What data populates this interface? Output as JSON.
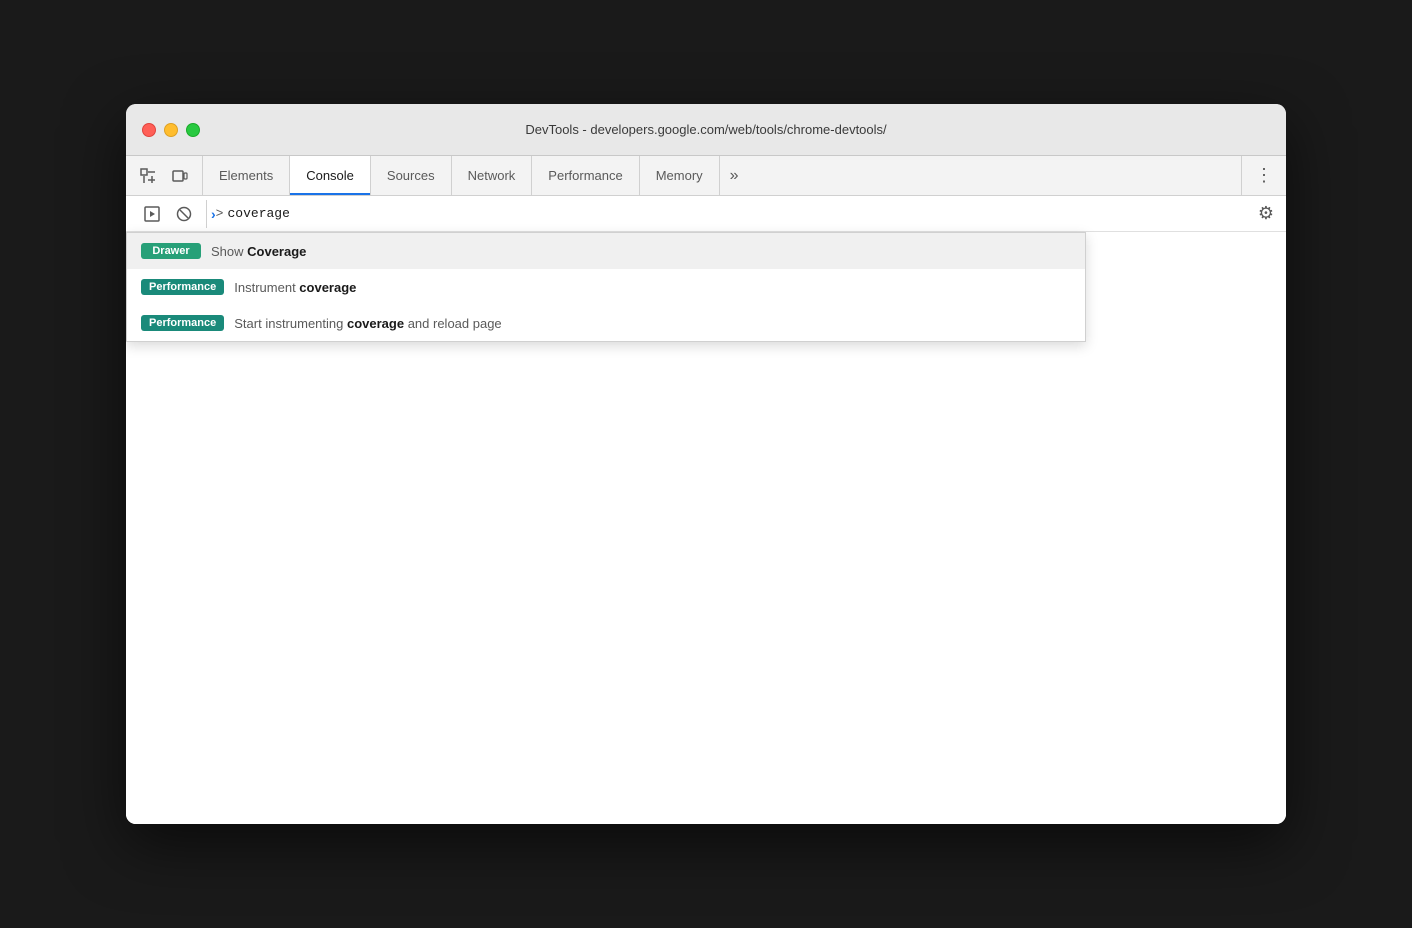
{
  "window": {
    "title": "DevTools - developers.google.com/web/tools/chrome-devtools/"
  },
  "traffic_lights": {
    "close_label": "close",
    "minimize_label": "minimize",
    "maximize_label": "maximize"
  },
  "tabs": [
    {
      "id": "elements",
      "label": "Elements",
      "active": false
    },
    {
      "id": "console",
      "label": "Console",
      "active": true
    },
    {
      "id": "sources",
      "label": "Sources",
      "active": false
    },
    {
      "id": "network",
      "label": "Network",
      "active": false
    },
    {
      "id": "performance",
      "label": "Performance",
      "active": false
    },
    {
      "id": "memory",
      "label": "Memory",
      "active": false
    }
  ],
  "tab_more_label": "»",
  "console_input": {
    "prompt": ">",
    "value": "coverage",
    "display": ">coverage"
  },
  "autocomplete": {
    "items": [
      {
        "badge_text": "Drawer",
        "badge_class": "badge-drawer",
        "text_before": "Show ",
        "text_bold": "Coverage",
        "text_after": "",
        "highlighted": true
      },
      {
        "badge_text": "Performance",
        "badge_class": "badge-performance",
        "text_before": "Instrument ",
        "text_bold": "coverage",
        "text_after": "",
        "highlighted": false
      },
      {
        "badge_text": "Performance",
        "badge_class": "badge-performance",
        "text_before": "Start instrumenting ",
        "text_bold": "coverage",
        "text_after": " and reload page",
        "highlighted": false
      }
    ]
  },
  "icons": {
    "inspect": "⬚",
    "device": "⬜",
    "run": "▶",
    "clear": "⊘",
    "chevron": "›",
    "more_vert": "⋮",
    "settings": "⚙"
  }
}
